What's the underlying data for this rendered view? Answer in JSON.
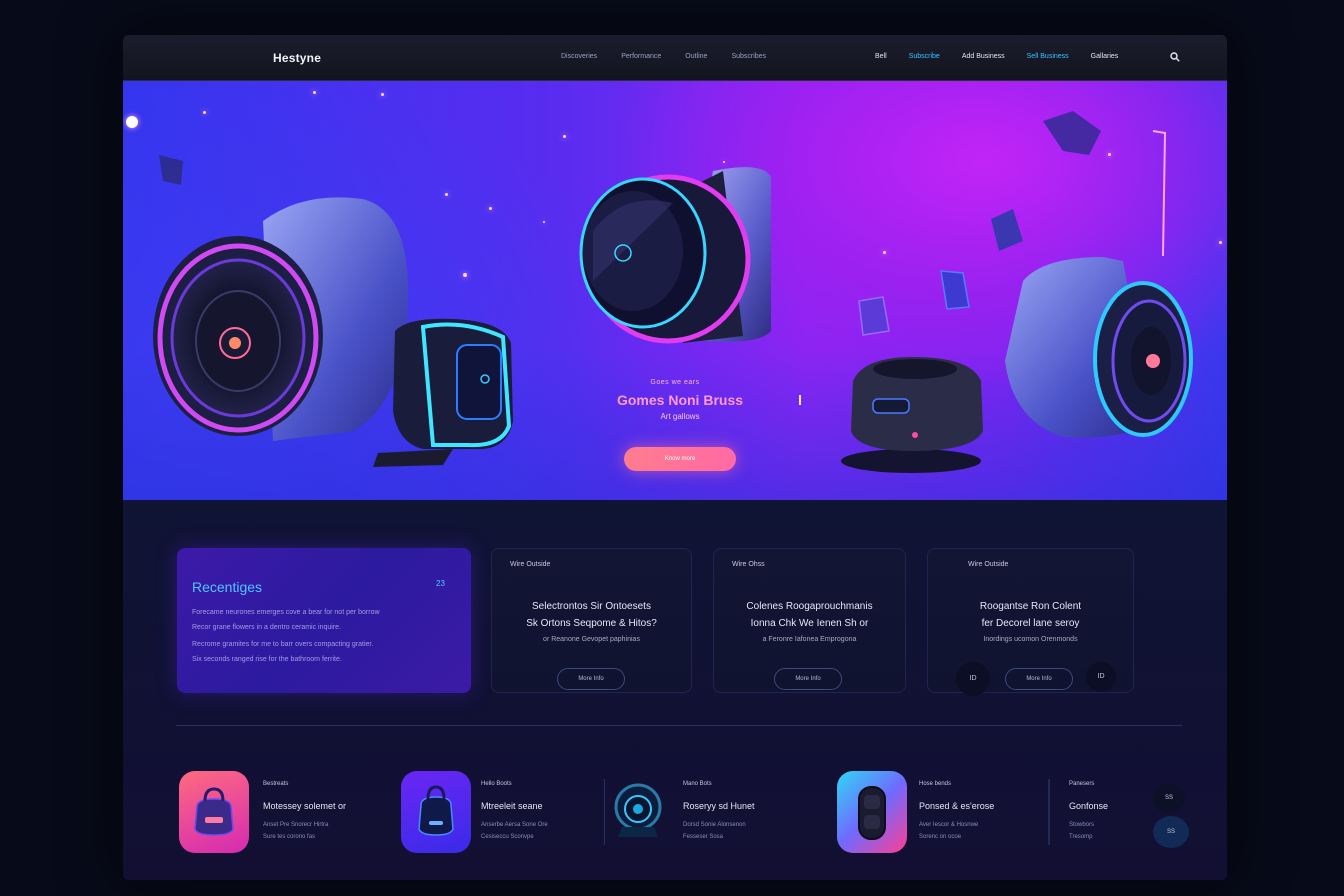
{
  "nav": {
    "logo": "Hestyne",
    "links": [
      "Discoveries",
      "Performance",
      "Outline",
      "Subscribes"
    ],
    "right": [
      "Bell",
      "Subscribe",
      "Add Business",
      "Sell Business",
      "Gallaries"
    ],
    "search_icon": "search-icon"
  },
  "hero": {
    "kicker": "Goes we ears",
    "title": "Gomes Noni Bruss",
    "subtitle": "Art gallows",
    "cta": "Know more"
  },
  "feature": {
    "title": "Recentiges",
    "badge": "23",
    "lines": [
      "Forecame neurones emerges cove a bear for not per borrow",
      "Recor grane flowers in a dentro ceramic inquire.",
      "Recrome gramites for me to barr overs compacting gratier.",
      "Six seconds ranged rise for the bathroom ferrite."
    ]
  },
  "cards": [
    {
      "label": "Wire Outside",
      "line1": "Selectrontos Sir Ontoesets",
      "line2": "Sk Ortons Seqpome & Hitos?",
      "line3": "or Reanone Gevopet paphinias",
      "button": "More Info"
    },
    {
      "label": "Wire Ohss",
      "line1": "Colenes Roogaprouchmanis",
      "line2": "Ionna Chk We Ienen Sh or",
      "line3": "a Feronre Iafonea Emprogona",
      "button": "More Info"
    },
    {
      "label": "Wire Outside",
      "line1": "Roogantse Ron Colent",
      "line2": "fer Decorel lane seroy",
      "line3": "Inordings ucomon Orenmonds",
      "button": "More Info",
      "left_circle": "ID",
      "right_circle": "ID"
    }
  ],
  "products": [
    {
      "label": "Bestreats",
      "title": "Motessey solemet or",
      "d1": "Anset Pre Snorecr Hirtra",
      "d2": "Sure tes corono fas",
      "color_a": "#ff6a7f",
      "color_b": "#d52ab3"
    },
    {
      "label": "Hello Boots",
      "title": "Mtreeleit seane",
      "d1": "Anserbe Aersa Sone Ore",
      "d2": "Cesiseccu Sconvpe",
      "color_a": "#6a26f4",
      "color_b": "#3a2be8"
    },
    {
      "label": "Mano Bots",
      "title": "Roseryy sd Hunet",
      "d1": "Dorsd Sonie Alonsenon",
      "d2": "Fesseser Sosa",
      "color_a": "#0b1c3c",
      "color_b": "#0c2746"
    },
    {
      "label": "Hose bends",
      "title": "Ponsed & es'erose",
      "d1": "Aver Iescor & Hosnwe",
      "d2": "Sorenc on ocoe",
      "color_a": "#2fd8f3",
      "color_b": "#ff3e93"
    },
    {
      "label": "Panesers",
      "title": "Gonfonse",
      "d1": "Stowbors",
      "d2": "Tresomp",
      "color_a": "",
      "color_b": ""
    }
  ],
  "side_buttons": [
    "SS",
    "SS"
  ]
}
